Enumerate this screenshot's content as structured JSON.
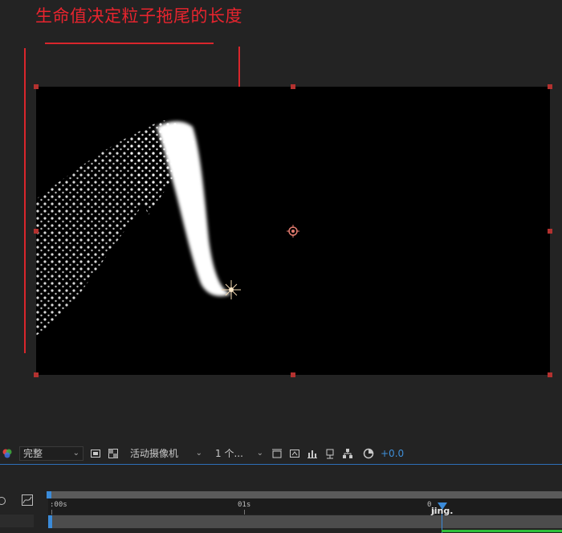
{
  "annotation": {
    "text": "生命值决定粒子拖尾的长度"
  },
  "toolbar": {
    "resolution_value": "完整",
    "camera_value": "活动摄像机",
    "views_value": "1 个...",
    "exposure_value": "+0.0"
  },
  "timeline": {
    "tick_0": ":00s",
    "tick_1": "01s",
    "tick_2": "0",
    "watermark": "jing."
  },
  "colors": {
    "annotation": "#e8242e",
    "accent_blue": "#3b8bd9",
    "handle_red": "#b3312f",
    "green_bar": "#2fbf3a"
  },
  "icons": [
    "color-channel-icon",
    "fit-view-icon",
    "transparency-grid-icon",
    "camera-options-icon",
    "snapshot-icon",
    "show-snapshot-icon",
    "channel-icon",
    "flowchart-icon",
    "exposure-reset-icon",
    "camera-icon",
    "graph-editor-icon"
  ]
}
